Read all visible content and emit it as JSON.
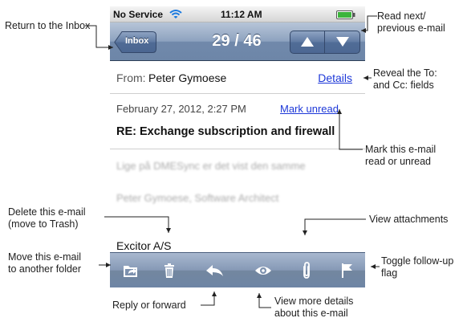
{
  "status_bar": {
    "carrier": "No Service",
    "time": "11:12 AM"
  },
  "nav_bar": {
    "back_label": "Inbox",
    "counter": "29 / 46"
  },
  "header": {
    "from_prefix": "From:",
    "sender": "Peter Gymoese",
    "details_link": "Details",
    "date": "February 27, 2012, 2:27 PM",
    "mark_unread_link": "Mark unread",
    "subject": "RE: Exchange subscription and firewall"
  },
  "body": {
    "line1": "Lige på DMESync er det vist den samme",
    "line2": "Peter Gymoese, Software Architect",
    "line3": "Excitor A/S"
  },
  "toolbar": {
    "icons": [
      "folder-move-icon",
      "trash-icon",
      "reply-icon",
      "eye-icon",
      "paperclip-icon",
      "flag-icon"
    ]
  },
  "callouts": {
    "return_inbox": "Return to the Inbox",
    "read_next_1": "Read next/",
    "read_next_2": "previous e-mail",
    "reveal_1": "Reveal the To:",
    "reveal_2": "and Cc: fields",
    "mark_1": "Mark this e-mail",
    "mark_2": "read or unread",
    "delete_1": "Delete this e-mail",
    "delete_2": "(move to Trash)",
    "view_attachments": "View attachments",
    "move_1": "Move this e-mail",
    "move_2": "to another folder",
    "flag_1": "Toggle follow-up",
    "flag_2": "flag",
    "reply": "Reply or forward",
    "view_more_1": "View more details",
    "view_more_2": "about this e-mail"
  },
  "colors": {
    "nav_bar": "#8da2bf",
    "link": "#1d38d8",
    "toolbar": "#8699b6"
  }
}
